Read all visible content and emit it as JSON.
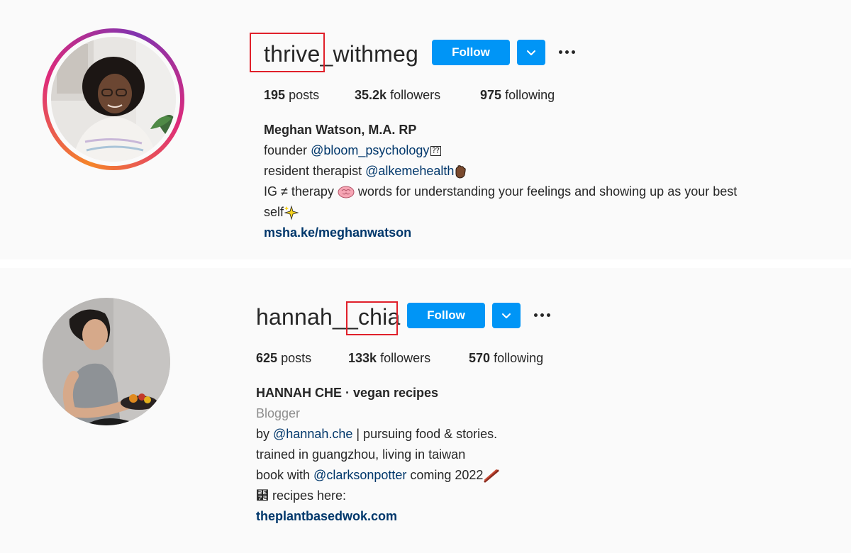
{
  "profiles": [
    {
      "username": "thrive_withmeg",
      "follow_label": "Follow",
      "stats": {
        "posts_count": "195",
        "posts_label": "posts",
        "followers_count": "35.2k",
        "followers_label": "followers",
        "following_count": "975",
        "following_label": "following"
      },
      "bio": {
        "full_name": "Meghan Watson, M.A. RP",
        "line1_prefix": "founder ",
        "line1_mention": "@bloom_psychology",
        "line2_prefix": "resident therapist ",
        "line2_mention": "@alkemehealth",
        "line3": "IG ≠ therapy ",
        "line3_rest": " words for understanding your feelings and showing up as your best",
        "line4": "self",
        "link": "msha.ke/meghanwatson"
      }
    },
    {
      "username": "hannah__chia",
      "follow_label": "Follow",
      "stats": {
        "posts_count": "625",
        "posts_label": "posts",
        "followers_count": "133k",
        "followers_label": "followers",
        "following_count": "570",
        "following_label": "following"
      },
      "bio": {
        "full_name": "HANNAH CHE · vegan recipes",
        "category": "Blogger",
        "line1_prefix": "by ",
        "line1_mention": "@hannah.che",
        "line1_rest": " | pursuing food & stories.",
        "line2": "trained in guangzhou, living in taiwan",
        "line3_prefix": "book with ",
        "line3_mention": "@clarksonpotter",
        "line3_rest": " coming 2022",
        "line4": "⹲ recipes here:",
        "link": "theplantbasedwok.com"
      }
    }
  ],
  "icons": {
    "dropdown": "chevron-down-icon",
    "more": "more-options-icon",
    "brain": "brain-emoji",
    "sparkles": "sparkles-emoji",
    "hand": "raised-hand-emoji",
    "chopsticks": "chopsticks-emoji"
  },
  "colors": {
    "follow_button": "#0095f6",
    "mention": "#00376b",
    "highlight_box": "#e0202a"
  }
}
